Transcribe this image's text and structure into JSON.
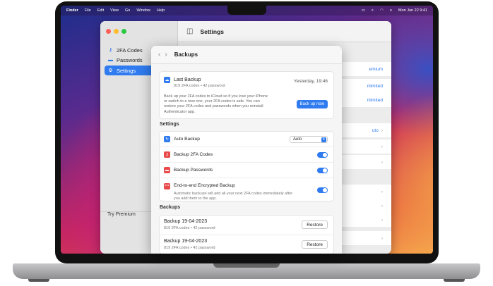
{
  "menubar": {
    "app_name": "Finder",
    "menus": [
      "File",
      "Edit",
      "View",
      "Go",
      "Window",
      "Help"
    ],
    "clock": "Mon Jun 22  9:41"
  },
  "sidebar": {
    "items": [
      {
        "label": "2FA Codes",
        "icon": "key-icon"
      },
      {
        "label": "Passwords",
        "icon": "card-icon"
      },
      {
        "label": "Settings",
        "icon": "gear-icon",
        "active": true
      }
    ],
    "try_premium": "Try Premium"
  },
  "main": {
    "title": "Settings",
    "ghost_labels": [
      "emium",
      "nlimited",
      "nlimited",
      "uto"
    ]
  },
  "sheet": {
    "title": "Backups",
    "last_backup": {
      "title": "Last Backup",
      "subtitle": "819 2FA codes • 42 password",
      "time": "Yesterday, 19:46",
      "description": "Back up your 2FA codes to iCloud so if you lose your iPhone or switch to a new one, your 2FA codes is safe. You can restore your 2FA codes and passwords when you reinstall Authenticator app.",
      "button": "Back up now"
    },
    "settings_label": "Settings",
    "settings": {
      "auto_backup": {
        "label": "Auto Backup",
        "value": "Auto"
      },
      "backup_2fa": {
        "label": "Backup 2FA Codes",
        "enabled": true
      },
      "backup_passwords": {
        "label": "Backup Passwords",
        "enabled": true
      },
      "e2e": {
        "label": "End-to-end Encrypted Backup",
        "description": "Automatic backups will add all your next 2FA codes immediately after you add them to the app.",
        "enabled": true
      }
    },
    "backups_label": "Backups",
    "backups": [
      {
        "title": "Backup 19-04-2023",
        "subtitle": "819 2FA codes • 42 password",
        "button": "Restore"
      },
      {
        "title": "Backup 19-04-2023",
        "subtitle": "819 2FA codes • 42 password",
        "button": "Restore"
      }
    ]
  },
  "colors": {
    "accent": "#2f7bef",
    "red": "#e84a4a"
  }
}
